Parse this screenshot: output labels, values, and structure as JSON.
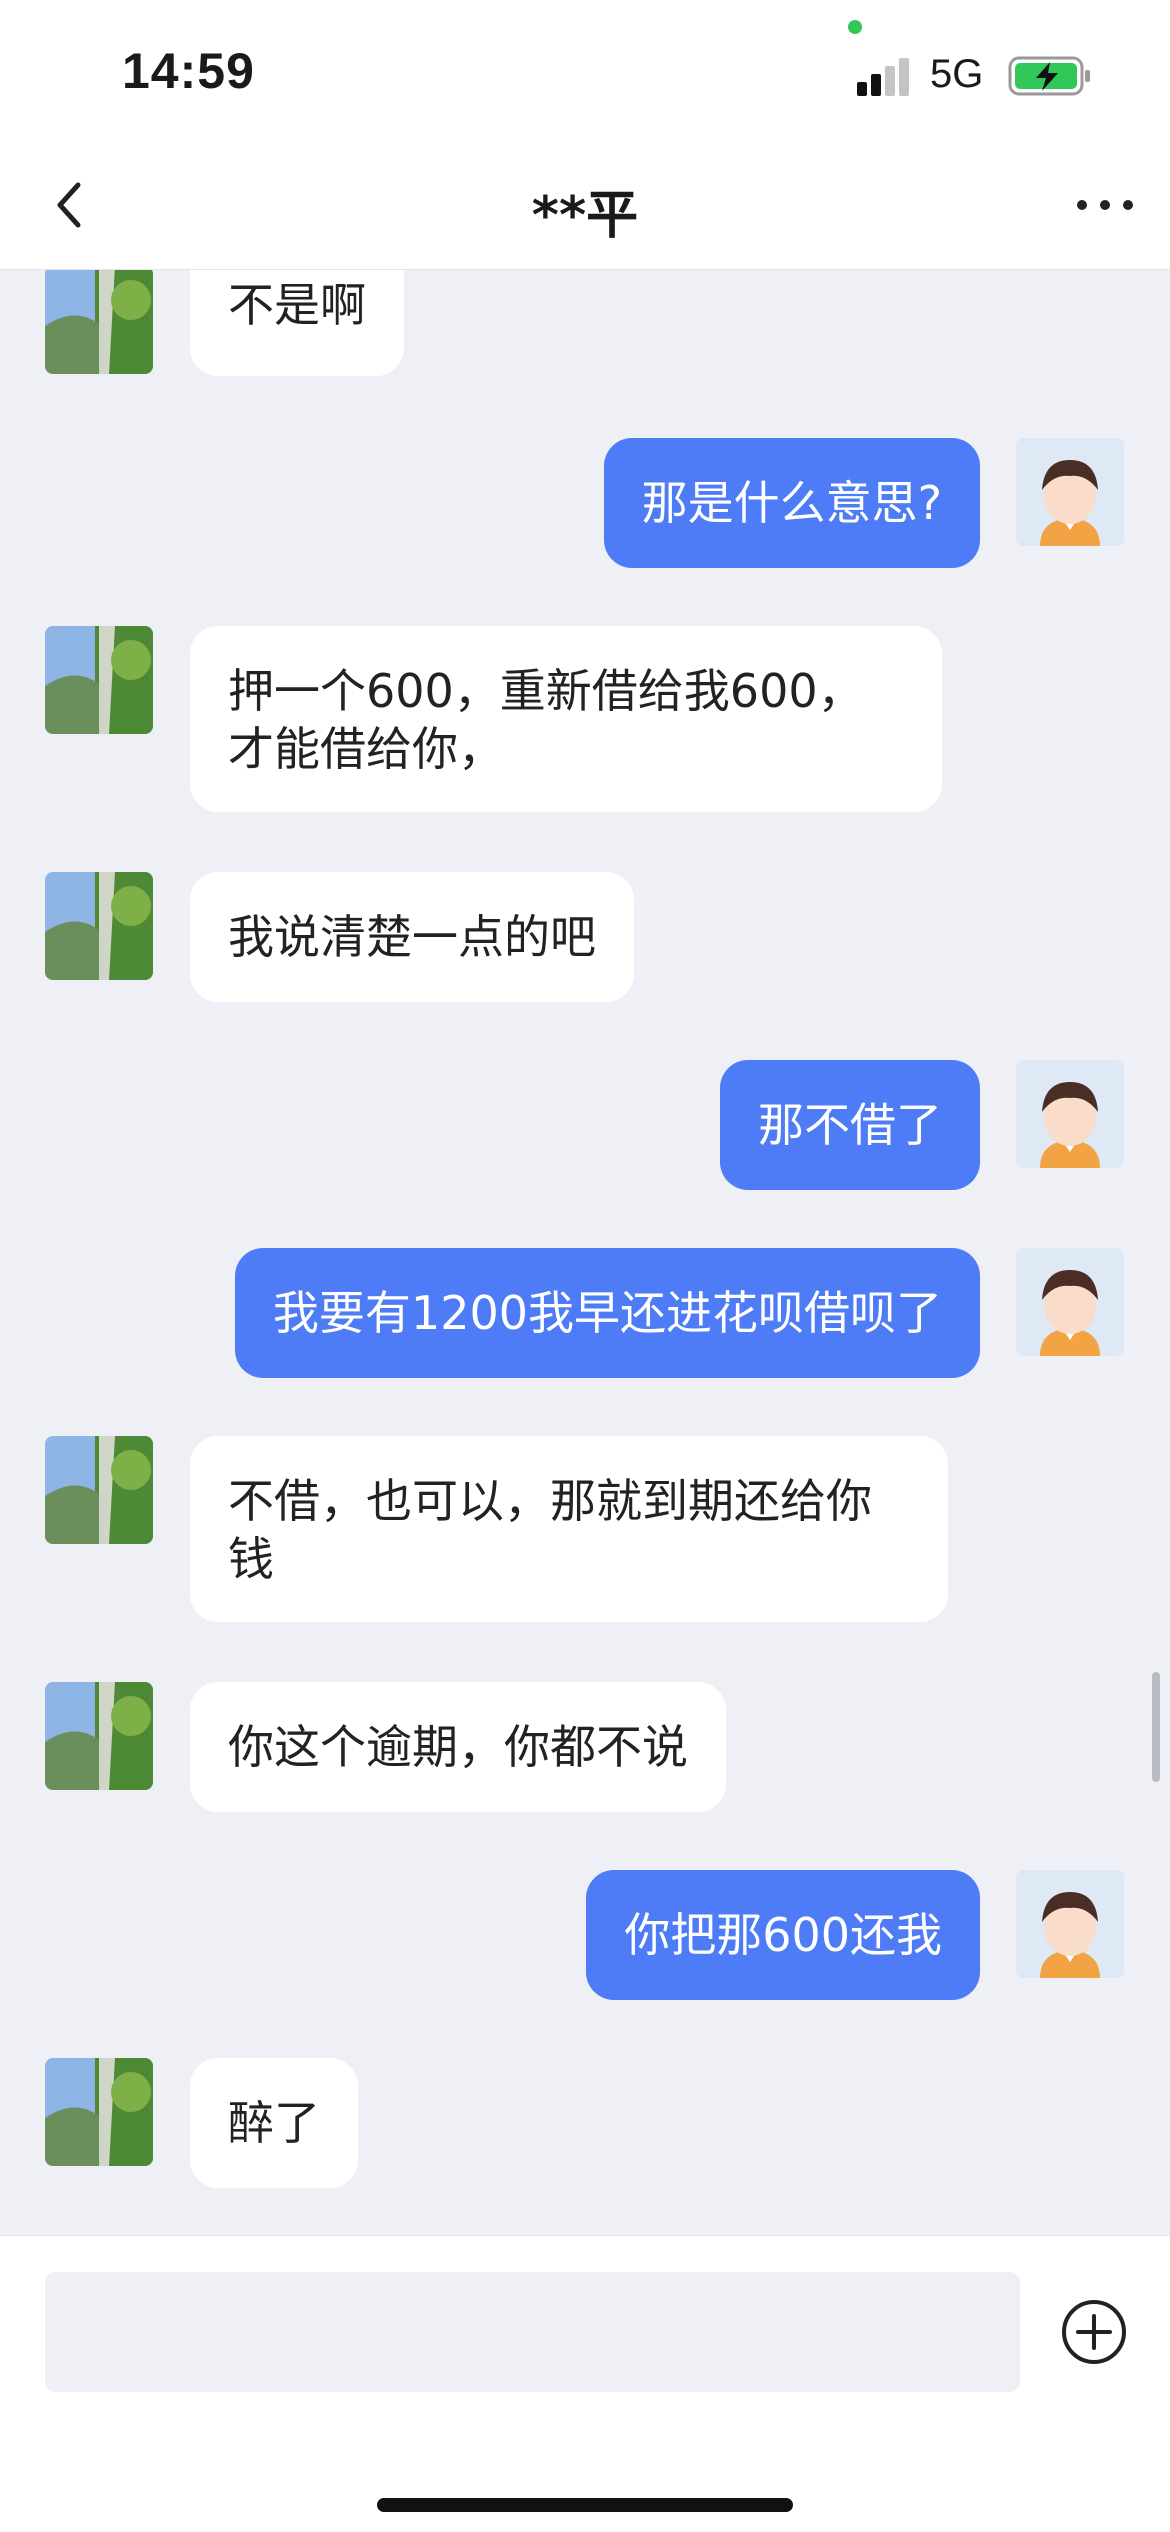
{
  "status_bar": {
    "time": "14:59",
    "network": "5G",
    "signal_icon": "cellular-signal-icon",
    "battery_icon": "battery-charging-icon"
  },
  "nav": {
    "title": "**平",
    "back_icon": "chevron-left-icon",
    "more_icon": "more-horizontal-icon"
  },
  "messages": [
    {
      "side": "left",
      "text": "不是啊"
    },
    {
      "side": "right",
      "text": "那是什么意思?"
    },
    {
      "side": "left",
      "text": "押一个600，重新借给我600，才能借给你，"
    },
    {
      "side": "left",
      "text": "我说清楚一点的吧"
    },
    {
      "side": "right",
      "text": "那不借了"
    },
    {
      "side": "right",
      "text": "我要有1200我早还进花呗借呗了"
    },
    {
      "side": "left",
      "text": "不借，也可以，那就到期还给你钱"
    },
    {
      "side": "left",
      "text": "你这个逾期，你都不说"
    },
    {
      "side": "right",
      "text": "你把那600还我"
    },
    {
      "side": "left",
      "text": "醉了"
    }
  ],
  "input": {
    "value": "",
    "placeholder": "",
    "plus_icon": "plus-circle-icon"
  },
  "colors": {
    "outgoing_bubble": "#4e7cf6",
    "incoming_bubble": "#ffffff",
    "background": "#eef0f5"
  }
}
